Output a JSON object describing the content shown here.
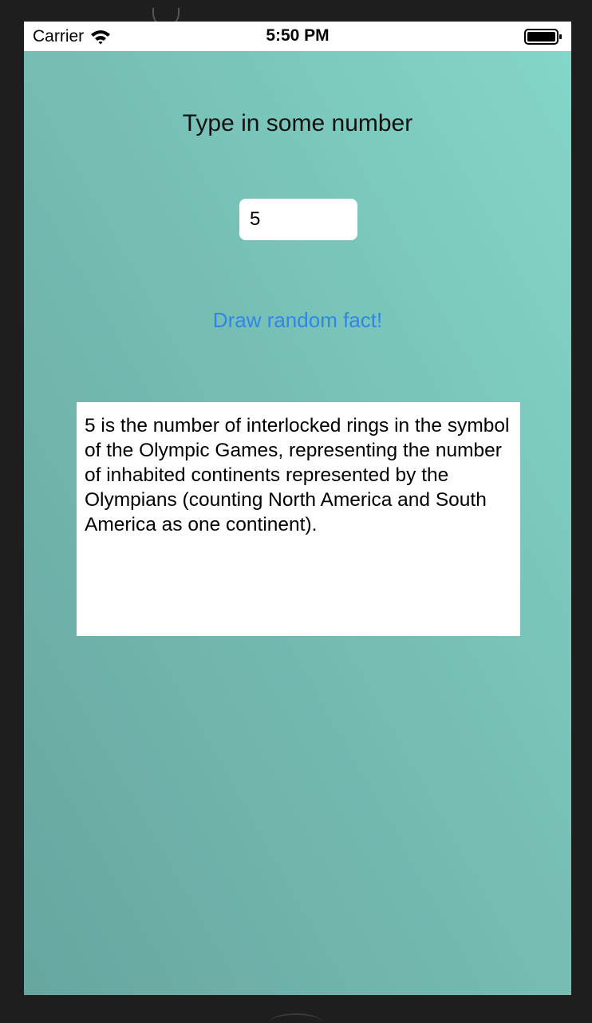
{
  "status_bar": {
    "carrier": "Carrier",
    "time": "5:50 PM",
    "icons": [
      "wifi-icon",
      "battery-icon"
    ]
  },
  "main": {
    "title": "Type in some number",
    "number_input": {
      "value": "5"
    },
    "draw_button_label": "Draw random fact!",
    "fact_text": "5 is the number of interlocked rings in the symbol of the Olympic Games, representing the number of inhabited continents represented by the Olympians (counting North America and South America as one continent)."
  },
  "colors": {
    "background_gradient_start": "#68a6a0",
    "background_gradient_end": "#84d7c9",
    "button_text": "#2f86e6",
    "panel": "#ffffff"
  }
}
